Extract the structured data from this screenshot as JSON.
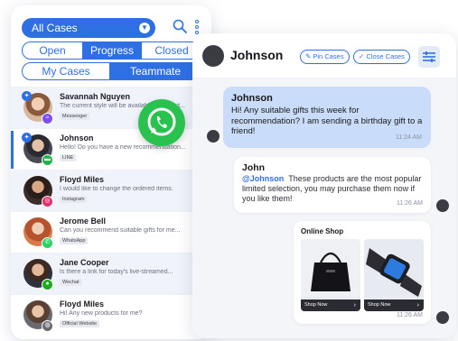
{
  "inbox": {
    "case_filter": "All Cases",
    "status_tabs": [
      "Open",
      "Progress",
      "Closed"
    ],
    "active_status": "Progress",
    "owner_tabs": [
      "My Cases",
      "Teammate"
    ],
    "active_owner": "Teammate",
    "conversations": [
      {
        "name": "Savannah Nguyen",
        "preview": "The current style will be available until next...",
        "channel": "Messenger",
        "channel_icon": "messenger-icon",
        "channel_color": "#7b4dff",
        "pinned": true
      },
      {
        "name": "Johnson",
        "preview": "Hello! Do you have a new recommendation...",
        "channel": "LINE",
        "channel_icon": "line-icon",
        "channel_color": "#22b24c",
        "pinned": true,
        "selected": true
      },
      {
        "name": "Floyd Miles",
        "preview": "I would like to change the ordered items.",
        "channel": "Instagram",
        "channel_icon": "instagram-icon",
        "channel_color": "#e1306c"
      },
      {
        "name": "Jerome Bell",
        "preview": "Can you recommend suitable gifts for me...",
        "channel": "WhatsApp",
        "channel_icon": "whatsapp-icon",
        "channel_color": "#25d366"
      },
      {
        "name": "Jane Cooper",
        "preview": "Is there a link for today's live-streamed...",
        "channel": "Wechat",
        "channel_icon": "wechat-icon",
        "channel_color": "#1aad19"
      },
      {
        "name": "Floyd Miles",
        "preview": "Hi! Any new products for me?",
        "channel": "Official Website",
        "channel_icon": "website-icon",
        "channel_color": "#6c6c74"
      }
    ]
  },
  "chat": {
    "contact_name": "Johnson",
    "pin_label": "Pin Cases",
    "close_label": "Close Cases",
    "incoming": {
      "sender": "Johnson",
      "text": "Hi! Any suitable gifts this week for recommendation? I am sending a birthday gift to a friend!",
      "time": "11:24 AM"
    },
    "outgoing": {
      "sender": "John",
      "mention": "@Johnson",
      "text": "These products are the most popular limited selection, you may purchase them now if you like them!",
      "time": "11:26 AM"
    },
    "shop": {
      "title": "Online Shop",
      "products": [
        {
          "cta": "Shop Now",
          "image_icon": "handbag-icon"
        },
        {
          "cta": "Shop Now",
          "image_icon": "smartwatch-icon"
        }
      ],
      "time": "11:26 AM"
    }
  },
  "colors": {
    "accent": "#2f6fe4",
    "incoming_bubble": "#c9dcf9",
    "whatsapp": "#29c24f"
  }
}
